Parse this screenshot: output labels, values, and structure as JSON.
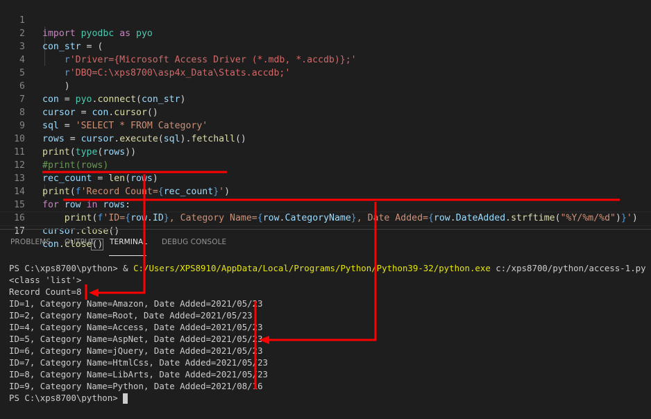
{
  "editor": {
    "lines": [
      {
        "n": "1",
        "text": "import pyodbc as pyo"
      },
      {
        "n": "2",
        "text": "con_str = ("
      },
      {
        "n": "3",
        "text": "    r'Driver={Microsoft Access Driver (*.mdb, *.accdb)};'"
      },
      {
        "n": "4",
        "text": "    r'DBQ=C:\\xps8700\\asp4x_Data\\Stats.accdb;'"
      },
      {
        "n": "5",
        "text": "    )"
      },
      {
        "n": "6",
        "text": "con = pyo.connect(con_str)"
      },
      {
        "n": "7",
        "text": "cursor = con.cursor()"
      },
      {
        "n": "8",
        "text": "sql = 'SELECT * FROM Category'"
      },
      {
        "n": "9",
        "text": "rows = cursor.execute(sql).fetchall()"
      },
      {
        "n": "10",
        "text": "print(type(rows))"
      },
      {
        "n": "11",
        "text": "#print(rows)"
      },
      {
        "n": "12",
        "text": "rec_count = len(rows)"
      },
      {
        "n": "13",
        "text": "print(f'Record Count={rec_count}')"
      },
      {
        "n": "14",
        "text": "for row in rows:"
      },
      {
        "n": "15",
        "text": "    print(f'ID={row.ID}, Category Name={row.CategoryName}, Date Added={row.DateAdded.strftime(\"%Y/%m/%d\")}')"
      },
      {
        "n": "16",
        "text": "cursor.close()"
      },
      {
        "n": "17",
        "text": "con.close()"
      }
    ],
    "active_line": "17"
  },
  "panel": {
    "tabs": [
      {
        "label": "PROBLEMS",
        "active": false
      },
      {
        "label": "OUTPUT",
        "active": false
      },
      {
        "label": "TERMINAL",
        "active": true
      },
      {
        "label": "DEBUG CONSOLE",
        "active": false
      }
    ]
  },
  "terminal": {
    "prompt": "PS C:\\xps8700\\python>",
    "command_amp": "&",
    "command_exe": "C:/Users/XPS8910/AppData/Local/Programs/Python/Python39-32/python.exe",
    "command_arg": "c:/xps8700/python/access-1.py",
    "output": [
      "<class 'list'>",
      "Record Count=8",
      "ID=1, Category Name=Amazon, Date Added=2021/05/23",
      "ID=2, Category Name=Root, Date Added=2021/05/23",
      "ID=4, Category Name=Access, Date Added=2021/05/23",
      "ID=5, Category Name=AspNet, Date Added=2021/05/23",
      "ID=6, Category Name=jQuery, Date Added=2021/05/23",
      "ID=7, Category Name=HtmlCss, Date Added=2021/05/23",
      "ID=8, Category Name=LibArts, Date Added=2021/05/23",
      "ID=9, Category Name=Python, Date Added=2021/08/16"
    ],
    "final_prompt": "PS C:\\xps8700\\python>"
  },
  "annotation": {
    "color": "#ff0000"
  }
}
